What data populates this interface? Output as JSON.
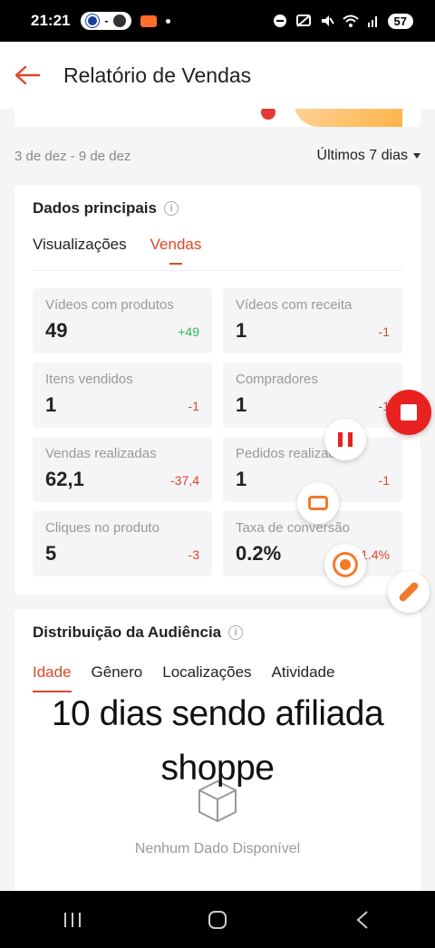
{
  "status_bar": {
    "time": "21:21",
    "battery": "57",
    "icons": [
      "team-badge-icon",
      "dash-icon",
      "team-badge-icon",
      "video-record-icon",
      "dot-icon",
      "minus-circle-icon",
      "cast-icon",
      "mute-icon",
      "wifi-icon",
      "signal-icon",
      "battery-icon"
    ],
    "pill_dash": "-"
  },
  "header": {
    "title": "Relatório de Vendas",
    "back_icon": "arrow-left-icon",
    "accent_color": "#e0452b"
  },
  "date_range": {
    "label": "3 de dez - 9 de dez",
    "selector": "Últimos 7 dias"
  },
  "key_data": {
    "title": "Dados principais",
    "tabs": [
      {
        "label": "Visualizações",
        "active": false
      },
      {
        "label": "Vendas",
        "active": true
      }
    ],
    "metrics": [
      {
        "label": "Vídeos com produtos",
        "value": "49",
        "delta": "+49",
        "trend": "up"
      },
      {
        "label": "Vídeos com receita",
        "value": "1",
        "delta": "-1",
        "trend": "down"
      },
      {
        "label": "Itens vendidos",
        "value": "1",
        "delta": "-1",
        "trend": "down"
      },
      {
        "label": "Compradores",
        "value": "1",
        "delta": "-1",
        "trend": "down"
      },
      {
        "label": "Vendas realizadas",
        "value": "62,1",
        "delta": "-37,4",
        "trend": "down"
      },
      {
        "label": "Pedidos realizados",
        "value": "1",
        "delta": "-1",
        "trend": "down"
      },
      {
        "label": "Cliques no produto",
        "value": "5",
        "delta": "-3",
        "trend": "down"
      },
      {
        "label": "Taxa de conversão",
        "value": "0.2%",
        "delta": "-1.4%",
        "trend": "down"
      }
    ]
  },
  "audience": {
    "title": "Distribuição da Audiência",
    "tabs": [
      {
        "label": "Idade",
        "active": true
      },
      {
        "label": "Gênero",
        "active": false
      },
      {
        "label": "Localizações",
        "active": false
      },
      {
        "label": "Atividade",
        "active": false
      }
    ],
    "empty_text": "Nenhum Dado Disponível"
  },
  "overlay_caption": {
    "line1": "10 dias sendo afiliada",
    "line2": "shoppe"
  },
  "colors": {
    "up": "#2fbd5a",
    "down": "#e0452b",
    "record": "#e82121",
    "tool_orange": "#f47a2a"
  }
}
